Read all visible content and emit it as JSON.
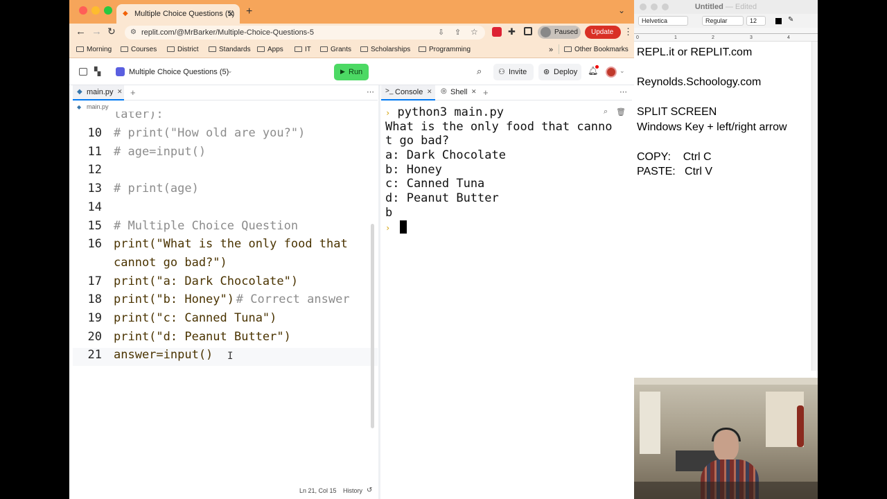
{
  "browser": {
    "tab_title": "Multiple Choice Questions (5)",
    "url": "replit.com/@MrBarker/Multiple-Choice-Questions-5",
    "paused_label": "Paused",
    "update_label": "Update",
    "bookmarks": [
      "Morning",
      "Courses",
      "District",
      "Standards",
      "Apps",
      "IT",
      "Grants",
      "Scholarships",
      "Programming"
    ],
    "other_bookmarks": "Other Bookmarks"
  },
  "replit": {
    "project_name": "Multiple Choice Questions (5)",
    "run_label": "Run",
    "invite_label": "Invite",
    "deploy_label": "Deploy",
    "editor_tab": "main.py",
    "breadcrumb": "main.py",
    "console_tab": "Console",
    "shell_tab": "Shell",
    "status_position": "Ln 21, Col 15",
    "history_label": "History"
  },
  "code": {
    "partial_top": "later):",
    "lines": [
      {
        "num": "10",
        "text": "# print(\"How old are you?\")"
      },
      {
        "num": "11",
        "text": "# age=input()"
      },
      {
        "num": "12",
        "text": ""
      },
      {
        "num": "13",
        "text": "# print(age)"
      },
      {
        "num": "14",
        "text": ""
      },
      {
        "num": "15",
        "text": "# Multiple Choice Question"
      },
      {
        "num": "16",
        "text": "print(\"What is the only food that"
      },
      {
        "num": "",
        "text": "cannot go bad?\")"
      },
      {
        "num": "17",
        "text": "print(\"a: Dark Chocolate\")"
      },
      {
        "num": "18",
        "text": "print(\"b: Honey\")",
        "comment": " # Correct answer"
      },
      {
        "num": "19",
        "text": "print(\"c: Canned Tuna\")"
      },
      {
        "num": "20",
        "text": "print(\"d: Peanut Butter\")"
      },
      {
        "num": "21",
        "text": "answer=input()"
      }
    ]
  },
  "console": {
    "command": "python3 main.py",
    "output": [
      "What is the only food that canno",
      "t go bad?",
      "a: Dark Chocolate",
      "b: Honey",
      "c: Canned Tuna",
      "d: Peanut Butter",
      "b"
    ]
  },
  "notes": {
    "title": "Untitled",
    "edited": "— Edited",
    "font": "Helvetica",
    "style": "Regular",
    "size": "12",
    "lines": [
      "REPL.it or REPLIT.com",
      "",
      "Reynolds.Schoology.com",
      "",
      "SPLIT SCREEN",
      "Windows Key + left/right arrow",
      "",
      "COPY:    Ctrl C",
      "PASTE:   Ctrl V"
    ],
    "ruler_marks": [
      "0",
      "1",
      "2",
      "3",
      "4"
    ]
  },
  "colors": {
    "tab_strip": "#f6a55a",
    "toolbar": "#fbe7d2",
    "run_button": "#4cd964",
    "update_button": "#d93025",
    "console_accent": "#0079f2"
  }
}
